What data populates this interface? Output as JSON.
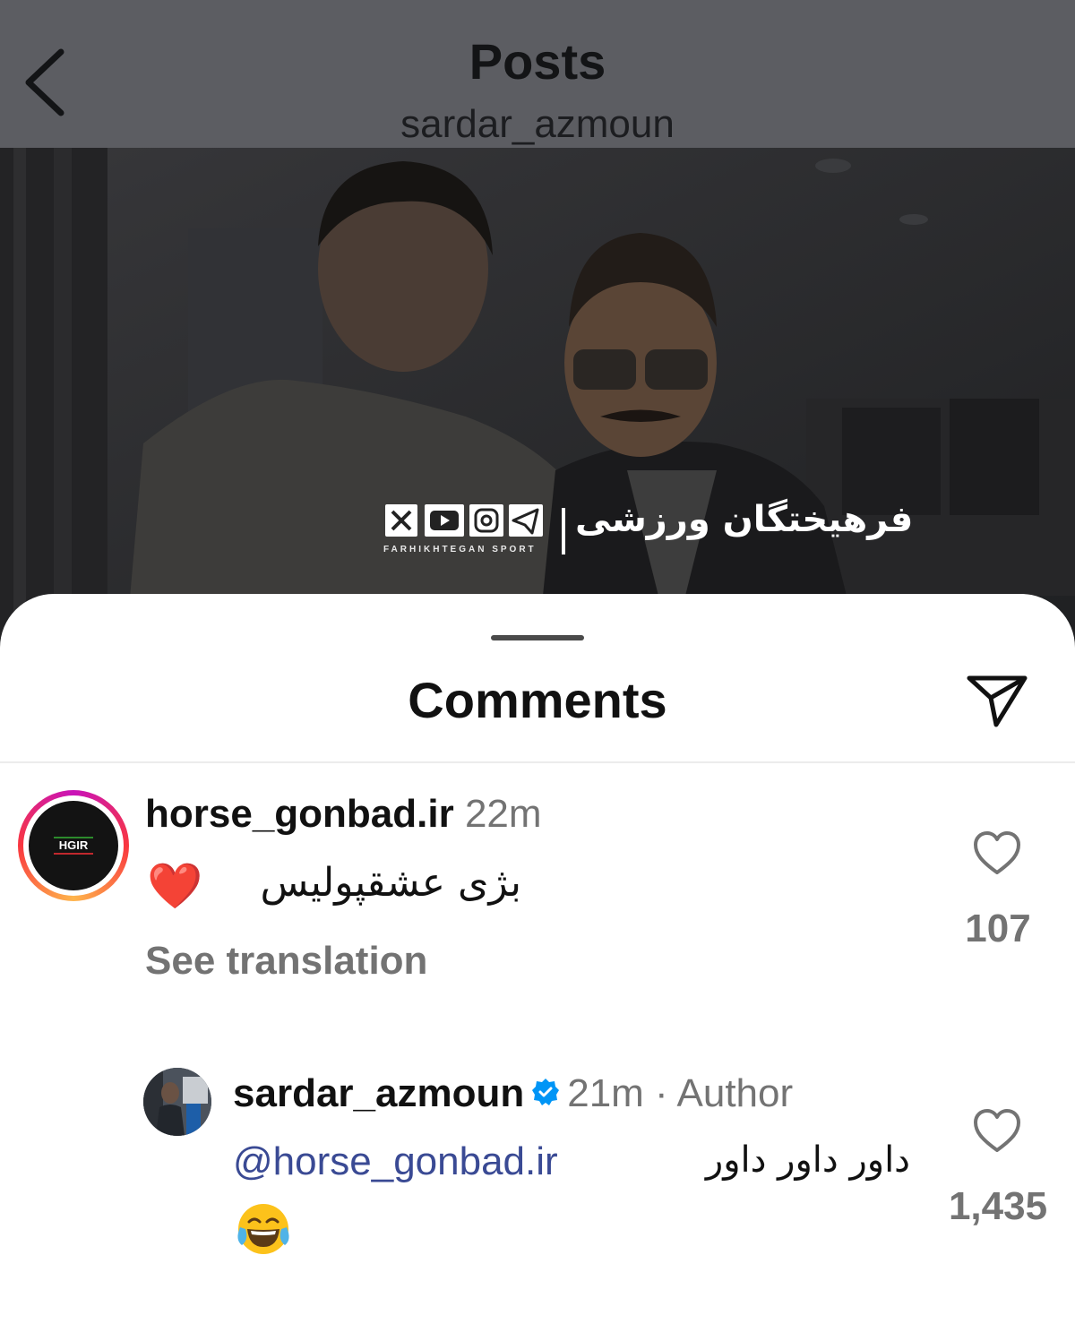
{
  "header": {
    "title": "Posts",
    "subtitle": "sardar_azmoun"
  },
  "photo": {
    "watermark_sport": "FARHIKHTEGAN SPORT",
    "watermark_logo": "فرهیختگان ورزشی"
  },
  "comments_sheet": {
    "title": "Comments"
  },
  "comments": [
    {
      "avatar_text": "HGIR",
      "username": "horse_gonbad.ir",
      "time": "22m",
      "emoji": "❤️",
      "text": "بژی عشقپولیس",
      "translate": "See translation",
      "likes": "107"
    },
    {
      "username": "sardar_azmoun",
      "time": "21m · Author",
      "mention": "@horse_gonbad.ir",
      "text": "داور داور داور",
      "emoji": "😂",
      "likes": "1,435"
    }
  ],
  "colors": {
    "topbar": "#5c5d62",
    "mention": "#3a4a94",
    "verified": "#0095f6",
    "secondary_text": "#737373"
  }
}
